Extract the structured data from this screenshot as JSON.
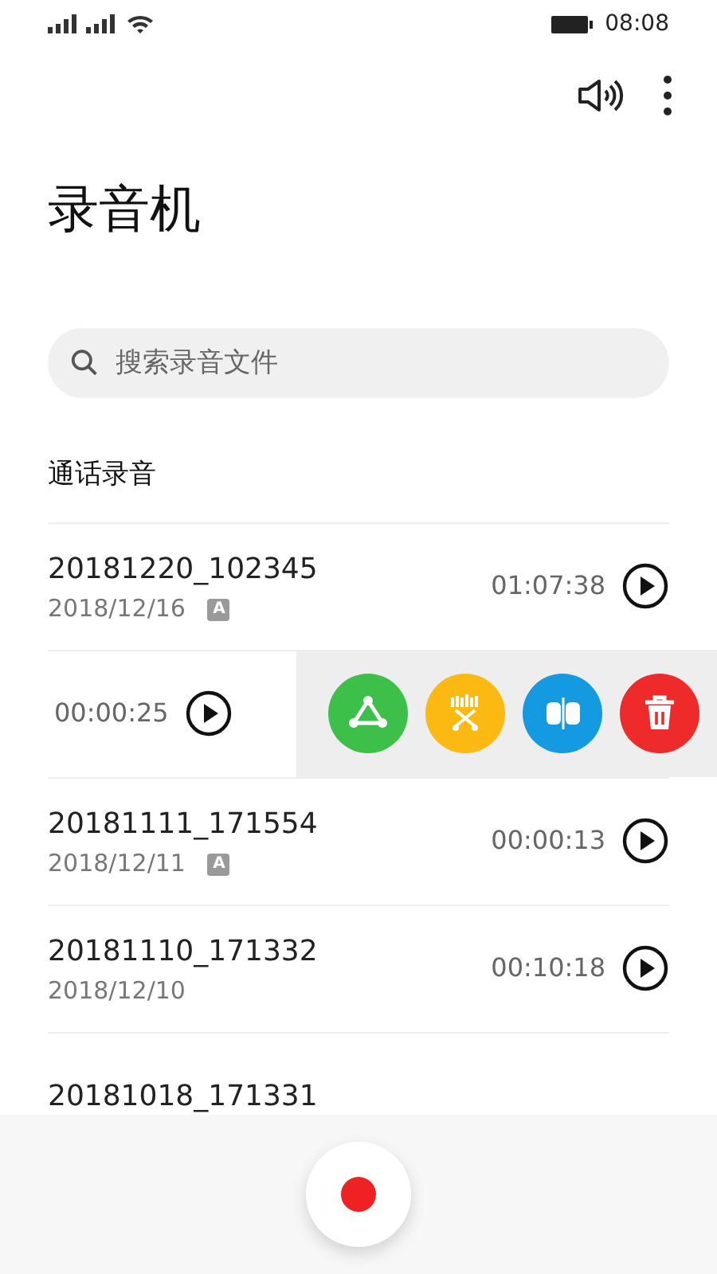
{
  "status_bar": {
    "time": "08:08"
  },
  "title": "录音机",
  "search": {
    "placeholder": "搜索录音文件"
  },
  "section": "通话录音",
  "recordings": [
    {
      "kind": "normal",
      "name": "20181220_102345",
      "date": "2018/12/16",
      "tag": "A",
      "duration": "01:07:38"
    },
    {
      "kind": "swiped",
      "duration": "00:00:25",
      "actions": [
        {
          "kind": "share",
          "color": "#3cc04a"
        },
        {
          "kind": "clip",
          "color": "#fbb911"
        },
        {
          "kind": "split",
          "color": "#139ae0"
        },
        {
          "kind": "delete",
          "color": "#ee2a2a"
        }
      ]
    },
    {
      "kind": "normal",
      "name": "20181111_171554",
      "date": "2018/12/11",
      "tag": "A",
      "duration": "00:00:13"
    },
    {
      "kind": "normal",
      "name": "20181110_171332",
      "date": "2018/12/10",
      "duration": "00:10:18"
    },
    {
      "kind": "normal",
      "name": "20181018_171331"
    }
  ]
}
